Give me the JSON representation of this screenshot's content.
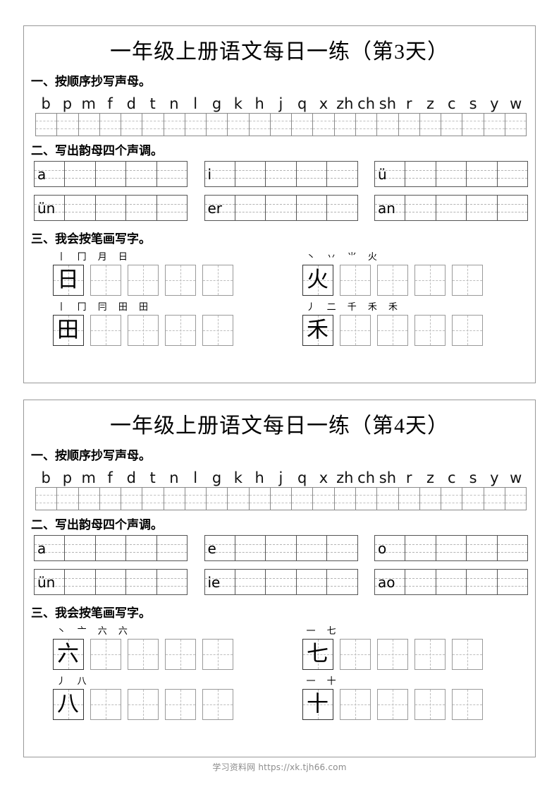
{
  "footer": {
    "watermark": "学习资料网 https://xk.tjh66.com"
  },
  "worksheets": [
    {
      "title": "一年级上册语文每日一练（第3天）",
      "sections": {
        "one": {
          "heading": "一、按顺序抄写声母。",
          "letters": [
            "b",
            "p",
            "m",
            "f",
            "d",
            "t",
            "n",
            "l",
            "g",
            "k",
            "h",
            "j",
            "q",
            "x",
            "zh",
            "ch",
            "sh",
            "r",
            "z",
            "c",
            "s",
            "y",
            "w"
          ],
          "grid_cells": 23
        },
        "two": {
          "heading": "二、写出韵母四个声调。",
          "rows": [
            [
              {
                "vowel": "a"
              },
              {
                "vowel": "i"
              },
              {
                "vowel": "ü"
              }
            ],
            [
              {
                "vowel": "ün"
              },
              {
                "vowel": "er"
              },
              {
                "vowel": "an"
              }
            ]
          ],
          "cells_per_grid": 5
        },
        "three": {
          "heading": "三、我会按笔画写字。",
          "rows": [
            [
              {
                "char": "日",
                "strokes": "丨 冂 月 日",
                "boxes": 5
              },
              {
                "char": "火",
                "strokes": "丶 丷 ⺌ 火",
                "boxes": 5
              }
            ],
            [
              {
                "char": "田",
                "strokes": "丨 冂 冃 田 田",
                "boxes": 5
              },
              {
                "char": "禾",
                "strokes": "丿 二 千 禾 禾",
                "boxes": 5
              }
            ]
          ]
        }
      }
    },
    {
      "title": "一年级上册语文每日一练（第4天）",
      "sections": {
        "one": {
          "heading": "一、按顺序抄写声母。",
          "letters": [
            "b",
            "p",
            "m",
            "f",
            "d",
            "t",
            "n",
            "l",
            "g",
            "k",
            "h",
            "j",
            "q",
            "x",
            "zh",
            "ch",
            "sh",
            "r",
            "z",
            "c",
            "s",
            "y",
            "w"
          ],
          "grid_cells": 23
        },
        "two": {
          "heading": "二、写出韵母四个声调。",
          "rows": [
            [
              {
                "vowel": "a"
              },
              {
                "vowel": "e"
              },
              {
                "vowel": "o"
              }
            ],
            [
              {
                "vowel": "ün"
              },
              {
                "vowel": "ie"
              },
              {
                "vowel": "ao"
              }
            ]
          ],
          "cells_per_grid": 5
        },
        "three": {
          "heading": "三、我会按笔画写字。",
          "rows": [
            [
              {
                "char": "六",
                "strokes": "丶 亠 六 六",
                "boxes": 5
              },
              {
                "char": "七",
                "strokes": "一 七",
                "boxes": 5
              }
            ],
            [
              {
                "char": "八",
                "strokes": "丿 八",
                "boxes": 5
              },
              {
                "char": "十",
                "strokes": "一 十",
                "boxes": 5
              }
            ]
          ]
        }
      }
    }
  ]
}
